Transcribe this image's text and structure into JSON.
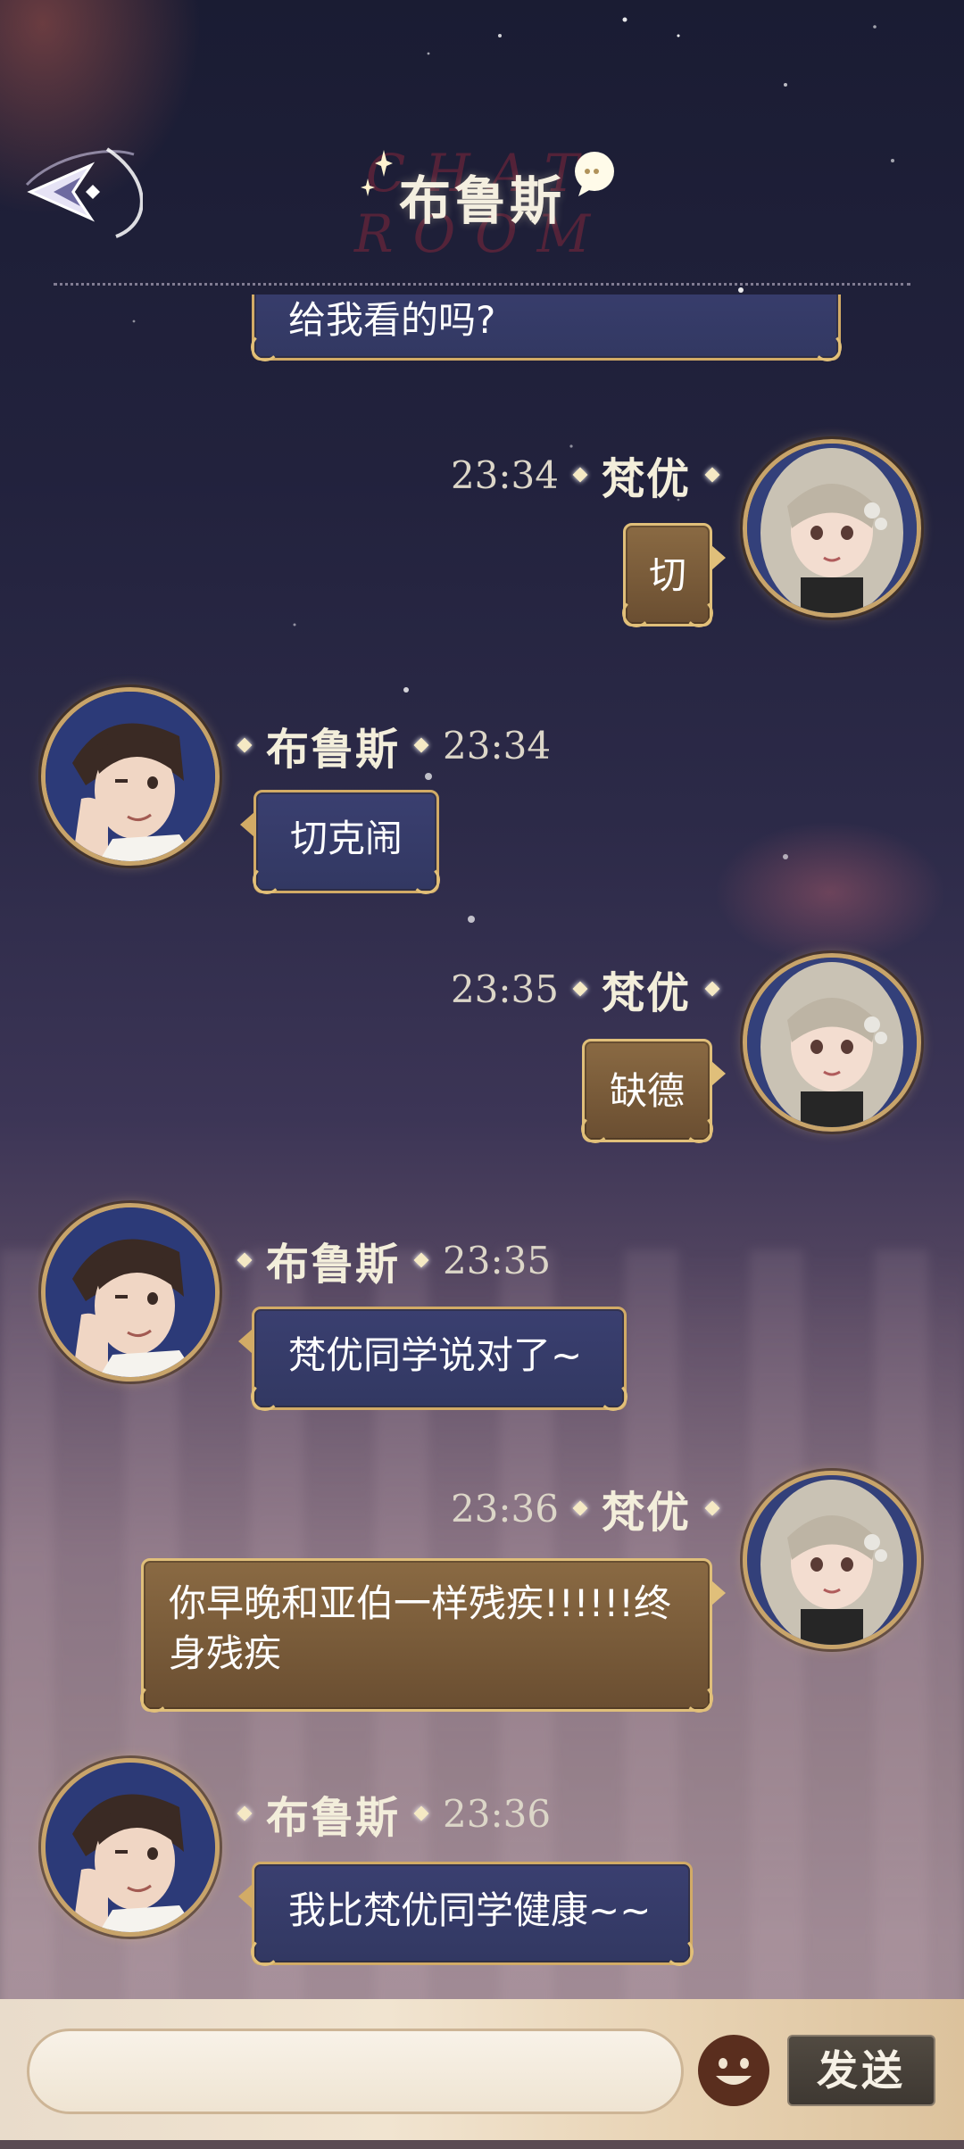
{
  "header": {
    "title": "布鲁斯",
    "watermark": "CHAT ROOM",
    "back_icon": "back-arrow-icon"
  },
  "messages": [
    {
      "side": "left",
      "sender": "",
      "time": "",
      "text": "给我看的吗?",
      "style": "blue"
    },
    {
      "side": "right",
      "sender": "梵优",
      "time": "23:34",
      "text": "切",
      "style": "gold"
    },
    {
      "side": "left",
      "sender": "布鲁斯",
      "time": "23:34",
      "text": "切克闹",
      "style": "blue"
    },
    {
      "side": "right",
      "sender": "梵优",
      "time": "23:35",
      "text": "缺德",
      "style": "gold"
    },
    {
      "side": "left",
      "sender": "布鲁斯",
      "time": "23:35",
      "text": "梵优同学说对了~",
      "style": "blue"
    },
    {
      "side": "right",
      "sender": "梵优",
      "time": "23:36",
      "text": "你早晚和亚伯一样残疾!!!!!!终身残疾",
      "style": "gold"
    },
    {
      "side": "left",
      "sender": "布鲁斯",
      "time": "23:36",
      "text": "我比梵优同学健康~~",
      "style": "blue"
    }
  ],
  "input": {
    "placeholder": "",
    "send_label": "发送",
    "emoji_icon": "emoji-face-icon"
  },
  "colors": {
    "bubble_blue": "#363b68",
    "bubble_gold": "#7a5c3a",
    "border_gold": "#d2ab66"
  }
}
